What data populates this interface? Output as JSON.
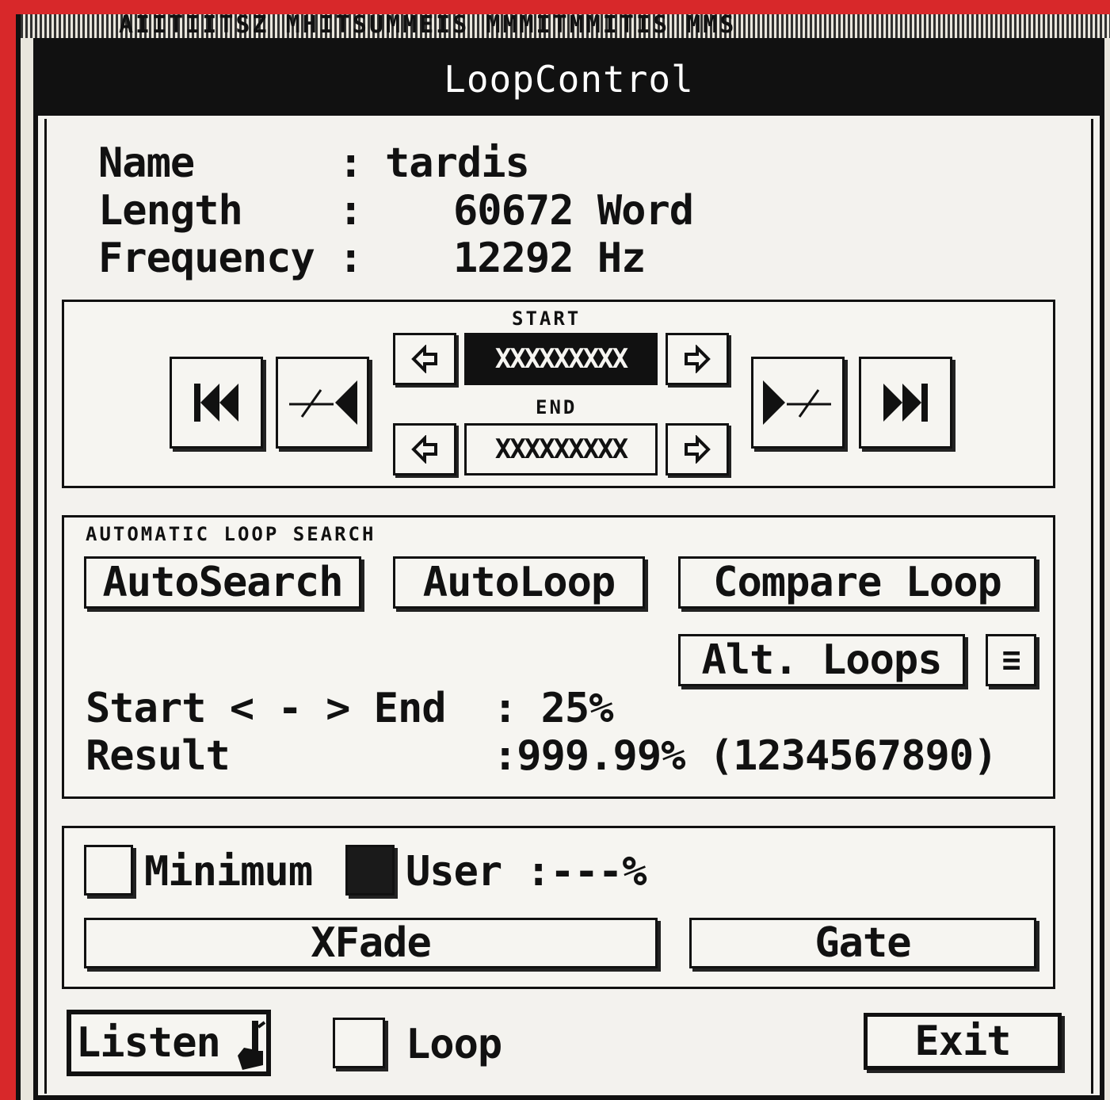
{
  "background": {
    "title_fragment": "AIITIITSZ MHITSUMMEIS MMMITMMITIS MMS"
  },
  "dialog": {
    "title": "LoopControl",
    "info": {
      "name_label": "Name      :",
      "name_value": "tardis",
      "length_label": "Length    :",
      "length_value": "60672 Word",
      "frequency_label": "Frequency :",
      "frequency_value": "12292 Hz"
    },
    "transport": {
      "start_label": "START",
      "end_label": "END",
      "start_value": "XXXXXXXXX",
      "end_value": "XXXXXXXXX"
    },
    "auto_search": {
      "section_label": "AUTOMATIC LOOP SEARCH",
      "autosearch_label": "AutoSearch",
      "autoloop_label": "AutoLoop",
      "compare_label": "Compare Loop",
      "alt_loops_label": "Alt. Loops",
      "menu_glyph": "≡",
      "startend_label": "Start < - > End",
      "startend_value": ": 25%",
      "result_label": "Result",
      "result_value": ":999.99% (1234567890)"
    },
    "options": {
      "minimum_label": "Minimum",
      "minimum_checked": false,
      "user_label": "User",
      "user_checked": true,
      "user_value": ":---%",
      "xfade_label": "XFade",
      "gate_label": "Gate"
    },
    "footer": {
      "listen_label": "Listen",
      "loop_label": "Loop",
      "loop_checked": false,
      "exit_label": "Exit"
    }
  },
  "icons": {
    "rewind": "skip-to-start-icon",
    "left_marker": "left-marker-icon",
    "right_marker": "right-marker-icon",
    "forward": "skip-to-end-icon",
    "arrow_left": "left-arrow-icon",
    "arrow_right": "right-arrow-icon",
    "cursor": "pointer-hand-icon"
  },
  "colors": {
    "frame_red": "#d8282a",
    "ink": "#111111",
    "paper": "#f6f5f1"
  }
}
